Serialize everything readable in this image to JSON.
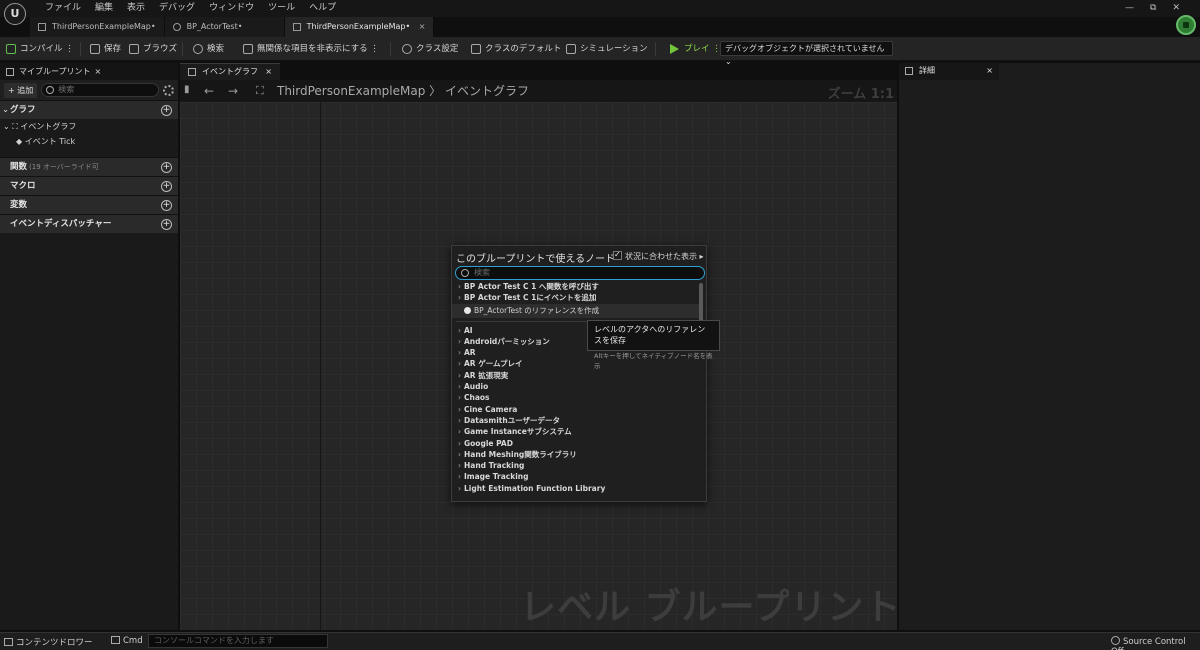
{
  "menu": [
    "ファイル",
    "編集",
    "表示",
    "デバッグ",
    "ウィンドウ",
    "ツール",
    "ヘルプ"
  ],
  "window_controls": [
    "—",
    "⧉",
    "✕"
  ],
  "doc_tabs": [
    {
      "label": "ThirdPersonExampleMap•"
    },
    {
      "label": "BP_ActorTest•"
    },
    {
      "label": "ThirdPersonExampleMap•",
      "close": "×"
    }
  ],
  "toolbar": {
    "compile": "コンパイル",
    "save": "保存",
    "browse": "ブラウズ",
    "search": "検索",
    "hide_unrelated": "無関係な項目を非表示にする",
    "class_settings": "クラス設定",
    "class_defaults": "クラスのデフォルト",
    "simulation": "シミュレーション",
    "play": "プレイ",
    "debug_dropdown": "デバッグオブジェクトが選択されていません ⌄"
  },
  "my_blueprint": {
    "tab_label": "マイブループリント",
    "close": "×",
    "add": "+ 追加",
    "search_placeholder": "検索",
    "sections": {
      "graph": "グラフ",
      "functions": "関数",
      "functions_sub": "(19 オーバーライド可",
      "macros": "マクロ",
      "variables": "変数",
      "dispatchers": "イベントディスパッチャー"
    },
    "tree": {
      "event_graph": "⌄ ⛶ イベントグラフ",
      "event_tick": "◆ イベント Tick"
    }
  },
  "graph": {
    "tab_label": "イベントグラフ",
    "close": "×",
    "back": "←",
    "forward": "→",
    "breadcrumb": "ThirdPersonExampleMap 〉 イベントグラフ",
    "zoom": "ズーム 1:1",
    "watermark": "レベル ブループリント"
  },
  "details": {
    "tab_label": "詳細",
    "close": "×"
  },
  "action_menu": {
    "title": "このブループリントで使えるノード",
    "context_label": "状況に合わせた表示 ▸",
    "search_placeholder": "検索",
    "top_rows": [
      "BP Actor Test C 1 へ関数を呼び出す",
      "BP Actor Test C 1にイベントを追加"
    ],
    "highlight_row": "BP_ActorTest のリファレンスを作成",
    "categories": [
      "AI",
      "Androidパーミッション",
      "AR",
      "AR ゲームプレイ",
      "AR 拡張現実",
      "Audio",
      "Chaos",
      "Cine Camera",
      "Datasmithユーザーデータ",
      "Game Instanceサブシステム",
      "Google PAD",
      "Hand Meshing関数ライブラリ",
      "Hand Tracking",
      "Image Tracking",
      "Light Estimation Function Library"
    ]
  },
  "tooltip": {
    "main": "レベルのアクタへのリファレンスを保存",
    "sub": "Altキーを押してネイティブノード名を表示"
  },
  "statusbar": {
    "content_drawer": "コンテンツドロワー",
    "cmd": "Cmd",
    "cmd_placeholder": "コンソールコマンドを入力します",
    "source_control": "Source Control Off"
  },
  "colors": {
    "accent_blue": "#2f9fd6",
    "play_green": "#73c63a",
    "record_green": "#2e7d32"
  }
}
